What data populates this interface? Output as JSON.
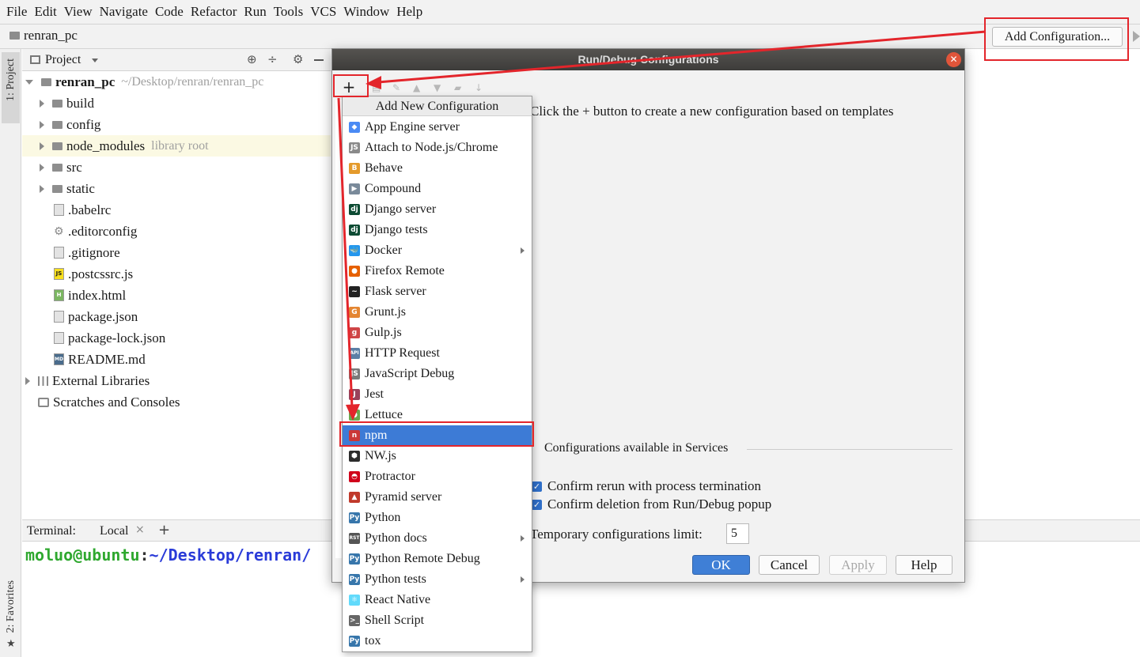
{
  "menu": [
    "File",
    "Edit",
    "View",
    "Navigate",
    "Code",
    "Refactor",
    "Run",
    "Tools",
    "VCS",
    "Window",
    "Help"
  ],
  "navbar": {
    "project_name": "renran_pc",
    "add_config_label": "Add Configuration..."
  },
  "side_tabs": {
    "project": "1: Project",
    "favorites": "2: Favorites"
  },
  "project_panel": {
    "header": "Project",
    "root": {
      "name": "renran_pc",
      "path": "~/Desktop/renran/renran_pc"
    },
    "folders": [
      {
        "name": "build"
      },
      {
        "name": "config"
      },
      {
        "name": "node_modules",
        "note": "library root"
      },
      {
        "name": "src"
      },
      {
        "name": "static"
      }
    ],
    "files": [
      {
        "name": ".babelrc",
        "icon": "config-file-icon"
      },
      {
        "name": ".editorconfig",
        "icon": "gear-file-icon"
      },
      {
        "name": ".gitignore",
        "icon": "ignore-file-icon"
      },
      {
        "name": ".postcssrc.js",
        "icon": "js-file-icon",
        "badge": "JS"
      },
      {
        "name": "index.html",
        "icon": "html-file-icon",
        "badge": "H"
      },
      {
        "name": "package.json",
        "icon": "json-file-icon"
      },
      {
        "name": "package-lock.json",
        "icon": "json-file-icon"
      },
      {
        "name": "README.md",
        "icon": "md-file-icon",
        "badge": "MD"
      }
    ],
    "external_libraries": "External Libraries",
    "scratches": "Scratches and Consoles"
  },
  "terminal": {
    "label": "Terminal:",
    "tab": "Local",
    "prompt_user": "moluo@ubuntu",
    "prompt_sep": ":",
    "prompt_path": "~/Desktop/renran/"
  },
  "dialog": {
    "title": "Run/Debug Configurations",
    "plus": "+",
    "hint": "Click the + button to create a new configuration based on templates",
    "services_label": "Configurations available in Services",
    "confirm_rerun": "Confirm rerun with process termination",
    "confirm_delete": "Confirm deletion from Run/Debug popup",
    "limit_label": "Temporary configurations limit:",
    "limit_value": "5",
    "buttons": {
      "ok": "OK",
      "cancel": "Cancel",
      "apply": "Apply",
      "help": "Help"
    }
  },
  "popup": {
    "title": "Add New Configuration",
    "selected": "npm",
    "items": [
      {
        "label": "App Engine server",
        "icon": "app-engine-icon",
        "glyph": "◆",
        "color": "#4a8af4",
        "submenu": false
      },
      {
        "label": "Attach to Node.js/Chrome",
        "icon": "attach-node-icon",
        "glyph": "JS",
        "color": "#8a8a8a",
        "submenu": false
      },
      {
        "label": "Behave",
        "icon": "behave-icon",
        "glyph": "B",
        "color": "#e49a2b",
        "submenu": false
      },
      {
        "label": "Compound",
        "icon": "compound-icon",
        "glyph": "▶",
        "color": "#7a8a9a",
        "submenu": false
      },
      {
        "label": "Django server",
        "icon": "django-server-icon",
        "glyph": "dj",
        "color": "#0c4b33",
        "submenu": false
      },
      {
        "label": "Django tests",
        "icon": "django-tests-icon",
        "glyph": "dj",
        "color": "#0c4b33",
        "submenu": false
      },
      {
        "label": "Docker",
        "icon": "docker-icon",
        "glyph": "🐳",
        "color": "#2496ed",
        "submenu": true
      },
      {
        "label": "Firefox Remote",
        "icon": "firefox-icon",
        "glyph": "●",
        "color": "#e66000",
        "submenu": false
      },
      {
        "label": "Flask server",
        "icon": "flask-icon",
        "glyph": "~",
        "color": "#222222",
        "submenu": false
      },
      {
        "label": "Grunt.js",
        "icon": "grunt-icon",
        "glyph": "G",
        "color": "#e48632",
        "submenu": false
      },
      {
        "label": "Gulp.js",
        "icon": "gulp-icon",
        "glyph": "g",
        "color": "#cf4647",
        "submenu": false
      },
      {
        "label": "HTTP Request",
        "icon": "http-request-icon",
        "glyph": "API",
        "color": "#5b7fa6",
        "submenu": false
      },
      {
        "label": "JavaScript Debug",
        "icon": "js-debug-icon",
        "glyph": "JS",
        "color": "#7a7a7a",
        "submenu": false
      },
      {
        "label": "Jest",
        "icon": "jest-icon",
        "glyph": "J",
        "color": "#99425b",
        "submenu": false
      },
      {
        "label": "Lettuce",
        "icon": "lettuce-icon",
        "glyph": "●",
        "color": "#6aa84f",
        "submenu": false
      },
      {
        "label": "npm",
        "icon": "npm-icon",
        "glyph": "n",
        "color": "#cb3837",
        "submenu": false
      },
      {
        "label": "NW.js",
        "icon": "nwjs-icon",
        "glyph": "⬢",
        "color": "#2b2b2b",
        "submenu": false
      },
      {
        "label": "Protractor",
        "icon": "protractor-icon",
        "glyph": "◓",
        "color": "#d0021b",
        "submenu": false
      },
      {
        "label": "Pyramid server",
        "icon": "pyramid-icon",
        "glyph": "▲",
        "color": "#c0392b",
        "submenu": false
      },
      {
        "label": "Python",
        "icon": "python-icon",
        "glyph": "Py",
        "color": "#3776ab",
        "submenu": false
      },
      {
        "label": "Python docs",
        "icon": "python-docs-icon",
        "glyph": "RST",
        "color": "#555555",
        "submenu": true
      },
      {
        "label": "Python Remote Debug",
        "icon": "python-remote-debug-icon",
        "glyph": "Py",
        "color": "#3776ab",
        "submenu": false
      },
      {
        "label": "Python tests",
        "icon": "python-tests-icon",
        "glyph": "Py",
        "color": "#3776ab",
        "submenu": true
      },
      {
        "label": "React Native",
        "icon": "react-icon",
        "glyph": "⚛",
        "color": "#61dafb",
        "submenu": false
      },
      {
        "label": "Shell Script",
        "icon": "shell-script-icon",
        "glyph": ">_",
        "color": "#666666",
        "submenu": false
      },
      {
        "label": "tox",
        "icon": "tox-icon",
        "glyph": "Py",
        "color": "#3776ab",
        "submenu": false
      }
    ]
  },
  "annotation_color": "#e3252b"
}
